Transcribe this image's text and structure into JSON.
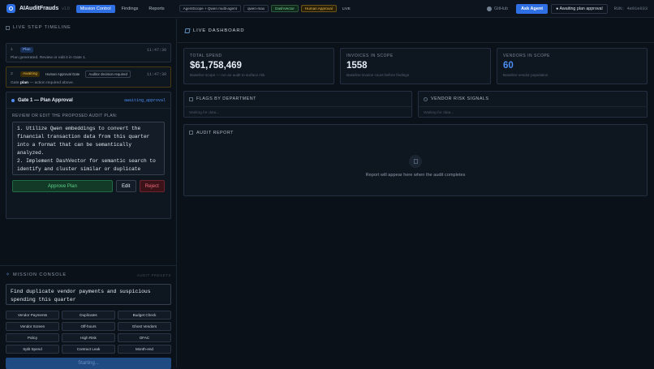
{
  "app": {
    "brand": "AIAuditFrauds",
    "version": "v1.0",
    "nav": [
      "Mission Control",
      "Findings",
      "Reports"
    ],
    "pills": [
      "AgentScope + Qwen multi-agent",
      "qwen-max",
      "DashVector",
      "Human Approval",
      "LIVE"
    ],
    "github": "GitHub",
    "ask": "Ask Agent",
    "awaiting": "● Awaiting plan approval",
    "run": "RUN: 4e91e033"
  },
  "timeline": {
    "title": "LIVE STEP TIMELINE",
    "steps": [
      {
        "num": "1",
        "tag": "Plan",
        "time": "11:47:30",
        "text": "Plan generated. Review or edit it in Gate 1."
      },
      {
        "num": "2",
        "tag": "Awaiting",
        "gate": "Human Approval Gate",
        "decision": "Auditor decision required",
        "time": "11:47:30",
        "text_a": "Gate",
        "text_b": "plan",
        "text_c": "— action required above."
      }
    ]
  },
  "approval": {
    "title": "Gate 1 — Plan Approval",
    "status": "awaiting_approval",
    "label": "REVIEW OR EDIT THE PROPOSED AUDIT PLAN:",
    "plan": "1. Utilize Qwen embeddings to convert the financial transaction data from this quarter into a format that can be semantically analyzed.\n2. Implement DashVector for semantic search to identify and cluster similar or duplicate vendor payments by analyzing the embedded transaction data.",
    "approve": "Approve Plan",
    "edit": "Edit",
    "reject": "Reject"
  },
  "console": {
    "title": "MISSION CONSOLE",
    "presets_label": "AUDIT PRESETS",
    "prompt": "Find duplicate vendor payments and suspicious spending this quarter",
    "presets": [
      "Vendor Payments",
      "Duplicates",
      "Budget Check",
      "Vendor Screen",
      "Off-hours",
      "Ghost Vendors",
      "Policy",
      "High Risk",
      "OFAC",
      "Split Spend",
      "Contract Leak",
      "Month-end"
    ],
    "start": "Starting..."
  },
  "dashboard": {
    "title": "LIVE DASHBOARD",
    "kpis": [
      {
        "label": "TOTAL SPEND",
        "value": "$61,758,469",
        "sub": "Baseline scope — run an audit to surface risk",
        "accent": "#e6edf5"
      },
      {
        "label": "INVOICES IN SCOPE",
        "value": "1558",
        "sub": "Baseline invoice count before findings",
        "accent": "#e6edf5"
      },
      {
        "label": "VENDORS IN SCOPE",
        "value": "60",
        "sub": "Baseline vendor population",
        "accent": "#4d8ef5"
      }
    ],
    "flags": {
      "title": "FLAGS BY DEPARTMENT",
      "wait": "Waiting for data..."
    },
    "signals": {
      "title": "VENDOR RISK SIGNALS",
      "wait": "Waiting for data..."
    },
    "report": {
      "title": "AUDIT REPORT",
      "empty": "Report will appear here when the audit completes"
    }
  }
}
